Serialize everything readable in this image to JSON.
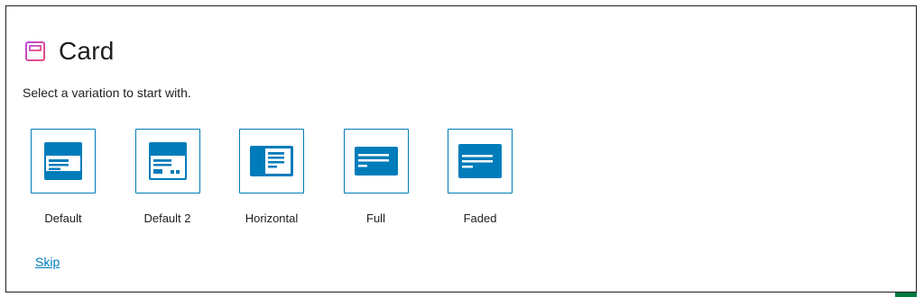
{
  "placeholder": {
    "icon": "card-block-icon",
    "title": "Card",
    "instructions": "Select a variation to start with.",
    "skip_label": "Skip"
  },
  "variations": [
    {
      "label": "Default",
      "icon": "card-default-icon"
    },
    {
      "label": "Default 2",
      "icon": "card-default-2-icon"
    },
    {
      "label": "Horizontal",
      "icon": "card-horizontal-icon"
    },
    {
      "label": "Full",
      "icon": "card-full-icon"
    },
    {
      "label": "Faded",
      "icon": "card-faded-icon"
    }
  ],
  "colors": {
    "accent": "#007cba",
    "text": "#1e1e1e",
    "icon_gradient_start": "#c04cd6",
    "icon_gradient_end": "#e8447a"
  }
}
